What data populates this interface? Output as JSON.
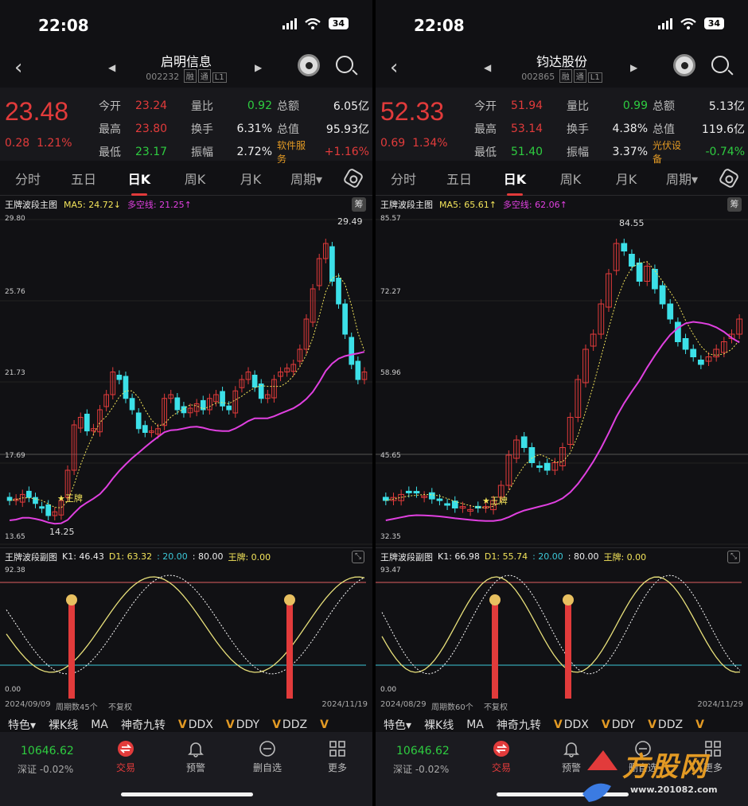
{
  "status": {
    "time": "22:08",
    "battery": "34"
  },
  "panels": [
    {
      "id": "left",
      "nav": {
        "title": "启明信息",
        "code": "002232",
        "tags": [
          "融",
          "通",
          "L1"
        ]
      },
      "quote": {
        "price": "23.48",
        "change": "0.28",
        "change_pct": "1.21%",
        "rows": [
          {
            "l1": "今开",
            "v1": "23.24",
            "l2": "量比",
            "v2": "0.92",
            "l3": "总额",
            "v3": "6.05亿"
          },
          {
            "l1": "最高",
            "v1": "23.80",
            "l2": "换手",
            "v2": "6.31%",
            "l3": "总值",
            "v3": "95.93亿"
          },
          {
            "l1": "最低",
            "v1": "23.17",
            "l2": "振幅",
            "v2": "2.72%",
            "l3": "软件服务",
            "v3": "+1.16%"
          }
        ]
      },
      "tabs": [
        "分时",
        "五日",
        "日K",
        "周K",
        "月K",
        "周期▾"
      ],
      "main_header": {
        "name": "王牌波段主图",
        "ma5": "MA5: 24.72↓",
        "dkx": "多空线: 21.25↑",
        "chou": "筹"
      },
      "y_labels": [
        "29.80",
        "25.76",
        "21.73",
        "17.69",
        "13.65"
      ],
      "high_label": "29.49",
      "low_label": "14.25",
      "wangpai_label": "王牌",
      "sub_header": {
        "name": "王牌波段副图",
        "k1": "K1: 46.43",
        "d1": "D1: 63.32",
        "a": ": 20.00",
        "b": ": 80.00",
        "wp": "王牌: 0.00"
      },
      "sub_y": [
        "92.38",
        "0.00"
      ],
      "dates": {
        "start": "2024/09/09",
        "count": "周期数45个",
        "mode": "不复权",
        "end": "2024/11/19"
      },
      "indicators": [
        "特色▾",
        "裸K线",
        "MA",
        "神奇九转",
        "DDX",
        "DDY",
        "DDZ",
        "V"
      ],
      "bottom": {
        "index_value": "10646.62",
        "index_name": "深证 -0.02%",
        "items": [
          "交易",
          "预警",
          "删自选",
          "更多"
        ]
      }
    },
    {
      "id": "right",
      "nav": {
        "title": "钧达股份",
        "code": "002865",
        "tags": [
          "融",
          "通",
          "L1"
        ]
      },
      "quote": {
        "price": "52.33",
        "change": "0.69",
        "change_pct": "1.34%",
        "rows": [
          {
            "l1": "今开",
            "v1": "51.94",
            "l2": "量比",
            "v2": "0.99",
            "l3": "总额",
            "v3": "5.13亿"
          },
          {
            "l1": "最高",
            "v1": "53.14",
            "l2": "换手",
            "v2": "4.38%",
            "l3": "总值",
            "v3": "119.6亿"
          },
          {
            "l1": "最低",
            "v1": "51.40",
            "l2": "振幅",
            "v2": "3.37%",
            "l3": "光伏设备",
            "v3": "-0.74%"
          }
        ]
      },
      "tabs": [
        "分时",
        "五日",
        "日K",
        "周K",
        "月K",
        "周期▾"
      ],
      "main_header": {
        "name": "王牌波段主图",
        "ma5": "MA5: 65.61↑",
        "dkx": "多空线: 62.06↑",
        "chou": "筹"
      },
      "y_labels": [
        "85.57",
        "72.27",
        "58.96",
        "45.65",
        "32.35"
      ],
      "high_label": "84.55",
      "low_label": "",
      "wangpai_label": "王牌",
      "sub_header": {
        "name": "王牌波段副图",
        "k1": "K1: 66.98",
        "d1": "D1: 55.74",
        "a": ": 20.00",
        "b": ": 80.00",
        "wp": "王牌: 0.00"
      },
      "sub_y": [
        "93.47",
        "0.00"
      ],
      "dates": {
        "start": "2024/08/29",
        "count": "周期数60个",
        "mode": "不复权",
        "end": "2024/11/29"
      },
      "indicators": [
        "特色▾",
        "裸K线",
        "MA",
        "神奇九转",
        "DDX",
        "DDY",
        "DDZ",
        "V"
      ],
      "bottom": {
        "index_value": "10646.62",
        "index_name": "深证 -0.02%",
        "items": [
          "交易",
          "预警",
          "删自选",
          "更多"
        ]
      }
    }
  ],
  "watermark": {
    "brand": "方股网",
    "url": "www.201082.com"
  },
  "colors": {
    "up": "#e23b3b",
    "down": "#3ce0e8",
    "ma5": "#f2e35a",
    "dkx": "#e040e0"
  }
}
